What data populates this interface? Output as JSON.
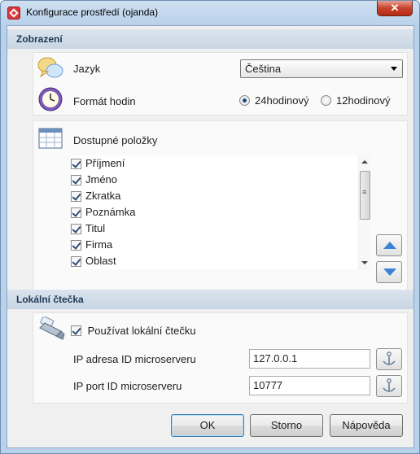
{
  "window": {
    "title": "Konfigurace prostředí (ojanda)",
    "close_glyph": "✕"
  },
  "display": {
    "section_title": "Zobrazení",
    "language": {
      "label": "Jazyk",
      "value": "Čeština"
    },
    "clock_format": {
      "label": "Formát hodin",
      "option_24": "24hodinový",
      "option_12": "12hodinový",
      "selected": "24hodinový"
    },
    "available_items": {
      "label": "Dostupné položky",
      "items": [
        {
          "label": "Příjmení",
          "checked": true
        },
        {
          "label": "Jméno",
          "checked": true
        },
        {
          "label": "Zkratka",
          "checked": true
        },
        {
          "label": "Poznámka",
          "checked": true
        },
        {
          "label": "Titul",
          "checked": true
        },
        {
          "label": "Firma",
          "checked": true
        },
        {
          "label": "Oblast",
          "checked": true
        }
      ]
    }
  },
  "reader": {
    "section_title": "Lokální čtečka",
    "use_local_reader": {
      "label": "Používat lokální čtečku",
      "checked": true
    },
    "ip_address": {
      "label": "IP adresa ID microserveru",
      "value": "127.0.0.1"
    },
    "ip_port": {
      "label": "IP port ID microserveru",
      "value": "10777"
    }
  },
  "buttons": {
    "ok": "OK",
    "cancel": "Storno",
    "help": "Nápověda"
  },
  "colors": {
    "accent": "#3b83d6",
    "header_text": "#1e3956"
  }
}
